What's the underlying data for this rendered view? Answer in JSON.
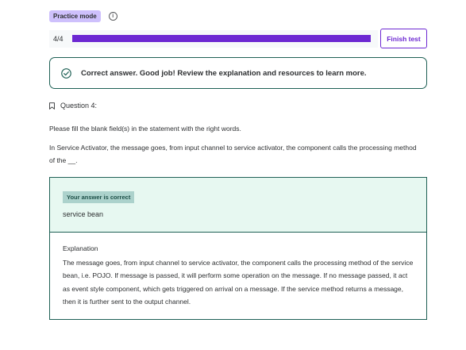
{
  "header": {
    "mode_badge": "Practice mode",
    "info_icon": "info-icon"
  },
  "progress": {
    "count_label": "4/4",
    "fraction": 1.0,
    "finish_label": "Finish test",
    "accent_color": "#6d28d2"
  },
  "feedback": {
    "icon": "check-circle-icon",
    "message": "Correct answer. Good job! Review the explanation and resources to learn more.",
    "color": "#1e6055"
  },
  "question": {
    "bookmark_icon": "bookmark-icon",
    "label": "Question 4:",
    "prompt": "Please fill the blank field(s) in the statement with the right words.",
    "statement": "In Service Activator, the message goes, from input channel to service activator, the component calls the processing method of the __."
  },
  "answer": {
    "status_tag": "Your answer is correct",
    "value": "service bean"
  },
  "explanation": {
    "title": "Explanation",
    "body": "The message goes, from input channel to service activator, the component calls the processing method of the service bean, i.e. POJO. If message is passed, it will perform some operation on the message. If no message passed, it act as event style component, which gets triggered on arrival on a message. If the service method returns a message, then it is further sent to the output channel."
  }
}
